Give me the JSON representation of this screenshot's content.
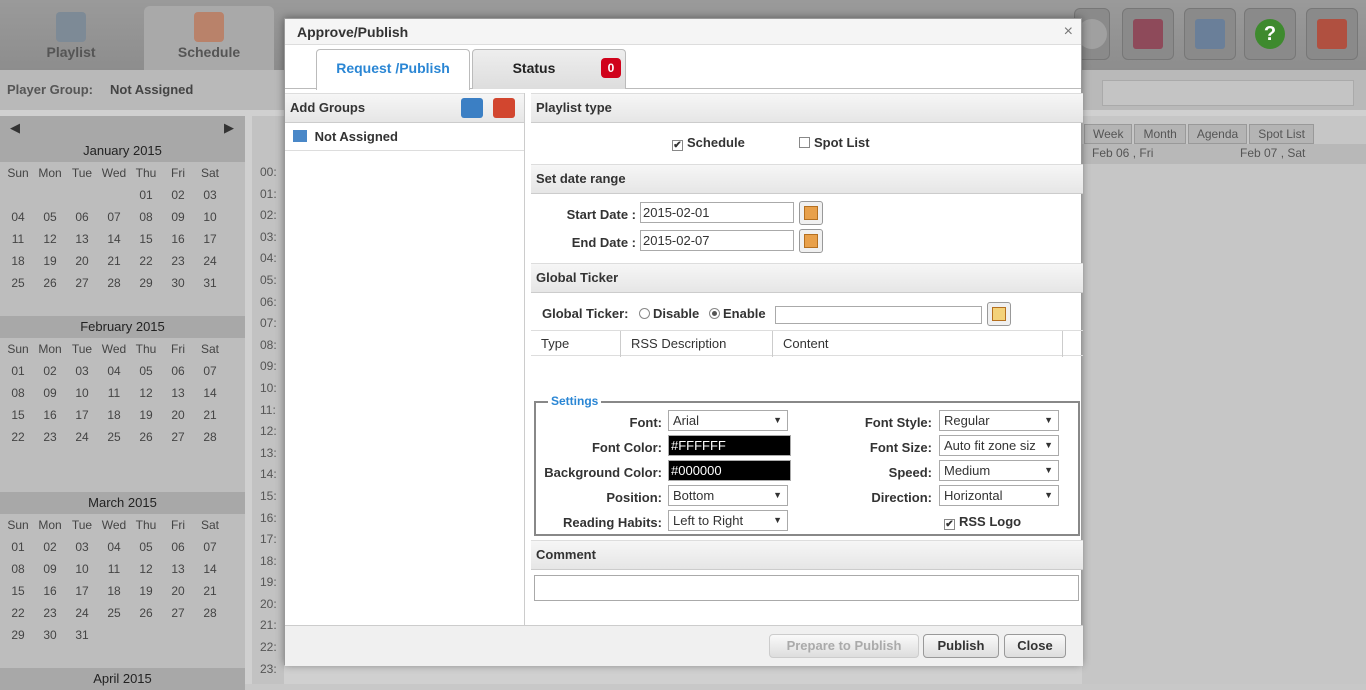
{
  "background": {
    "nav_tabs": [
      "Playlist",
      "Schedule"
    ],
    "player_group_label": "Player Group:",
    "player_group_value": "Not Assigned",
    "calendar": {
      "weekdays": [
        "Sun",
        "Mon",
        "Tue",
        "Wed",
        "Thu",
        "Fri",
        "Sat"
      ],
      "months": [
        {
          "name": "January 2015",
          "days": [
            "",
            "",
            "",
            "",
            "01",
            "02",
            "03",
            "04",
            "05",
            "06",
            "07",
            "08",
            "09",
            "10",
            "11",
            "12",
            "13",
            "14",
            "15",
            "16",
            "17",
            "18",
            "19",
            "20",
            "21",
            "22",
            "23",
            "24",
            "25",
            "26",
            "27",
            "28",
            "29",
            "30",
            "31"
          ]
        },
        {
          "name": "February 2015",
          "days": [
            "01",
            "02",
            "03",
            "04",
            "05",
            "06",
            "07",
            "08",
            "09",
            "10",
            "11",
            "12",
            "13",
            "14",
            "15",
            "16",
            "17",
            "18",
            "19",
            "20",
            "21",
            "22",
            "23",
            "24",
            "25",
            "26",
            "27",
            "28"
          ]
        },
        {
          "name": "March 2015",
          "days": [
            "01",
            "02",
            "03",
            "04",
            "05",
            "06",
            "07",
            "08",
            "09",
            "10",
            "11",
            "12",
            "13",
            "14",
            "15",
            "16",
            "17",
            "18",
            "19",
            "20",
            "21",
            "22",
            "23",
            "24",
            "25",
            "26",
            "27",
            "28",
            "29",
            "30",
            "31"
          ]
        }
      ],
      "april_label": "April 2015"
    },
    "hours": [
      "00:",
      "01:",
      "02:",
      "03:",
      "04:",
      "05:",
      "06:",
      "07:",
      "08:",
      "09:",
      "10:",
      "11:",
      "12:",
      "13:",
      "14:",
      "15:",
      "16:",
      "17:",
      "18:",
      "19:",
      "20:",
      "21:",
      "22:",
      "23:"
    ],
    "view_tabs": [
      "Week",
      "Month",
      "Agenda",
      "Spot List"
    ],
    "day_headers": [
      "Feb 06 , Fri",
      "Feb 07 , Sat"
    ]
  },
  "dialog": {
    "title": "Approve/Publish",
    "close_icon": "×",
    "tabs": {
      "request": "Request /Publish",
      "status": "Status",
      "status_badge": "0"
    },
    "left": {
      "header": "Add Groups",
      "group_item": "Not Assigned"
    },
    "playlist_type": {
      "header": "Playlist type",
      "schedule_label": "Schedule",
      "schedule_checked": true,
      "spot_label": "Spot List",
      "spot_checked": false
    },
    "date_range": {
      "header": "Set date range",
      "start_label": "Start Date :",
      "start_value": "2015-02-01",
      "end_label": "End Date :",
      "end_value": "2015-02-07"
    },
    "ticker": {
      "header": "Global Ticker",
      "label": "Global Ticker:",
      "disable": "Disable",
      "enable": "Enable",
      "columns": [
        "Type",
        "RSS Description",
        "Content"
      ]
    },
    "settings": {
      "legend": "Settings",
      "font_label": "Font:",
      "font_value": "Arial",
      "font_color_label": "Font Color:",
      "font_color_value": "#FFFFFF",
      "bg_color_label": "Background Color:",
      "bg_color_value": "#000000",
      "position_label": "Position:",
      "position_value": "Bottom",
      "reading_label": "Reading Habits:",
      "reading_value": "Left to Right",
      "font_style_label": "Font Style:",
      "font_style_value": "Regular",
      "font_size_label": "Font Size:",
      "font_size_value": "Auto fit zone siz",
      "speed_label": "Speed:",
      "speed_value": "Medium",
      "direction_label": "Direction:",
      "direction_value": "Horizontal",
      "rss_logo_label": "RSS Logo"
    },
    "comment": {
      "header": "Comment"
    },
    "footer": {
      "prepare": "Prepare to Publish",
      "publish": "Publish",
      "close": "Close"
    }
  }
}
